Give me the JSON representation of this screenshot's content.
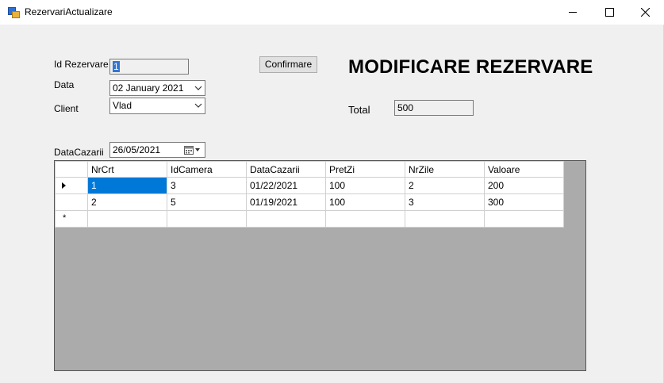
{
  "window": {
    "title": "RezervariActualizare",
    "minimize_icon": "minimize-icon",
    "maximize_icon": "maximize-icon",
    "close_icon": "close-icon"
  },
  "form": {
    "id_label": "Id Rezervare",
    "id_value": "1",
    "data_label": "Data",
    "data_value": "02   January   2021",
    "client_label": "Client",
    "client_value": "Vlad",
    "confirm_label": "Confirmare",
    "heading": "MODIFICARE REZERVARE",
    "total_label": "Total",
    "total_value": "500",
    "datacazarii_label": "DataCazarii",
    "datacazarii_value": "26/05/2021"
  },
  "grid": {
    "columns": [
      "NrCrt",
      "IdCamera",
      "DataCazarii",
      "PretZi",
      "NrZile",
      "Valoare"
    ],
    "rows": [
      [
        "1",
        "3",
        "01/22/2021",
        "100",
        "2",
        "200"
      ],
      [
        "2",
        "5",
        "01/19/2021",
        "100",
        "3",
        "300"
      ]
    ],
    "new_row_marker": "*"
  },
  "colors": {
    "selection": "#0078d7",
    "grid_background": "#ababab",
    "form_background": "#f0f0f0"
  }
}
